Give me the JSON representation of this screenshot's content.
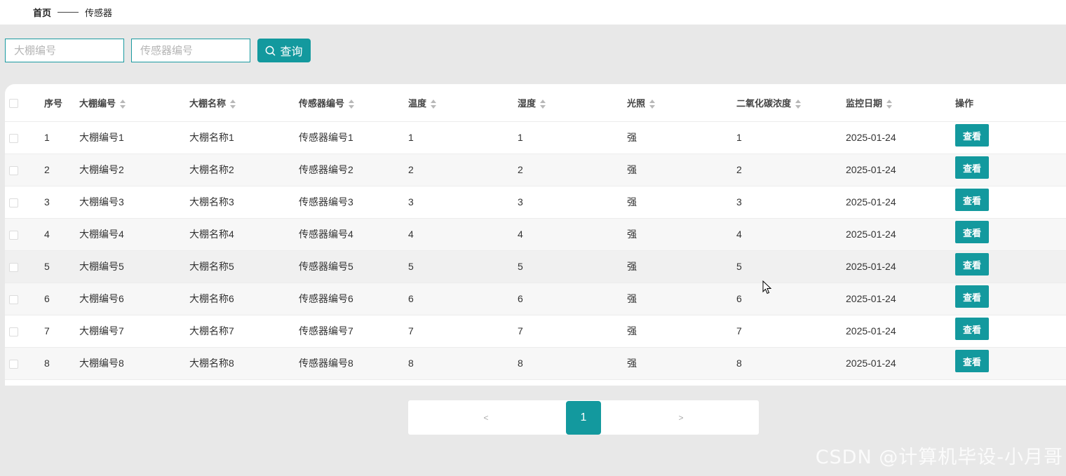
{
  "breadcrumb": {
    "home": "首页",
    "current": "传感器"
  },
  "search": {
    "greenhouse_placeholder": "大棚编号",
    "sensor_placeholder": "传感器编号",
    "button_label": "查询"
  },
  "table": {
    "headers": [
      "序号",
      "大棚编号",
      "大棚名称",
      "传感器编号",
      "温度",
      "湿度",
      "光照",
      "二氧化碳浓度",
      "监控日期",
      "操作"
    ],
    "action_label": "查看",
    "rows": [
      [
        "1",
        "大棚编号1",
        "大棚名称1",
        "传感器编号1",
        "1",
        "1",
        "强",
        "1",
        "2025-01-24"
      ],
      [
        "2",
        "大棚编号2",
        "大棚名称2",
        "传感器编号2",
        "2",
        "2",
        "强",
        "2",
        "2025-01-24"
      ],
      [
        "3",
        "大棚编号3",
        "大棚名称3",
        "传感器编号3",
        "3",
        "3",
        "强",
        "3",
        "2025-01-24"
      ],
      [
        "4",
        "大棚编号4",
        "大棚名称4",
        "传感器编号4",
        "4",
        "4",
        "强",
        "4",
        "2025-01-24"
      ],
      [
        "5",
        "大棚编号5",
        "大棚名称5",
        "传感器编号5",
        "5",
        "5",
        "强",
        "5",
        "2025-01-24"
      ],
      [
        "6",
        "大棚编号6",
        "大棚名称6",
        "传感器编号6",
        "6",
        "6",
        "强",
        "6",
        "2025-01-24"
      ],
      [
        "7",
        "大棚编号7",
        "大棚名称7",
        "传感器编号7",
        "7",
        "7",
        "强",
        "7",
        "2025-01-24"
      ],
      [
        "8",
        "大棚编号8",
        "大棚名称8",
        "传感器编号8",
        "8",
        "8",
        "强",
        "8",
        "2025-01-24"
      ]
    ]
  },
  "pagination": {
    "prev": "<",
    "current": "1",
    "next": ">"
  },
  "watermark": "CSDN @计算机毕设-小月哥",
  "colors": {
    "accent": "#13999e",
    "background": "#e8e8e8"
  },
  "icons": {
    "search": "search-icon",
    "cursor": "mouse-pointer-icon"
  }
}
